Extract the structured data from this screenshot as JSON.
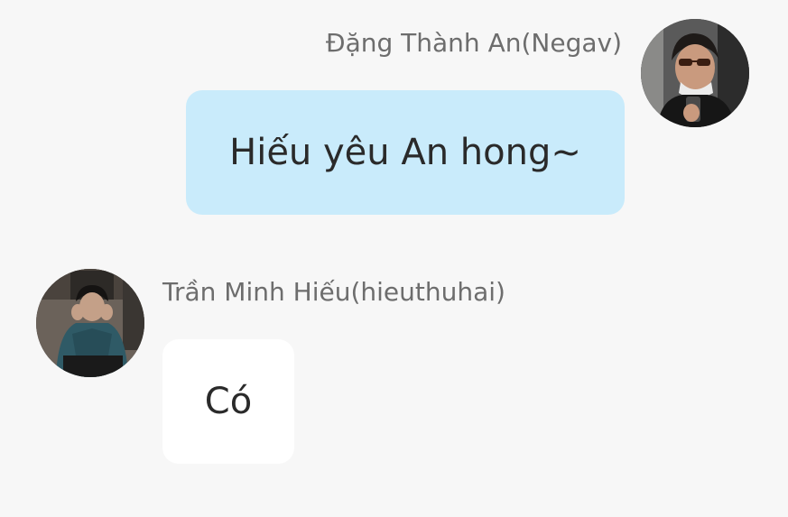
{
  "messages": [
    {
      "sender": "Đặng Thành An(Negav)",
      "text": "Hiếu yêu An hong~",
      "side": "right",
      "bubble_color": "#c9ebfb"
    },
    {
      "sender": "Trần Minh Hiếu(hieuthuhai)",
      "text": "Có",
      "side": "left",
      "bubble_color": "#ffffff"
    }
  ]
}
